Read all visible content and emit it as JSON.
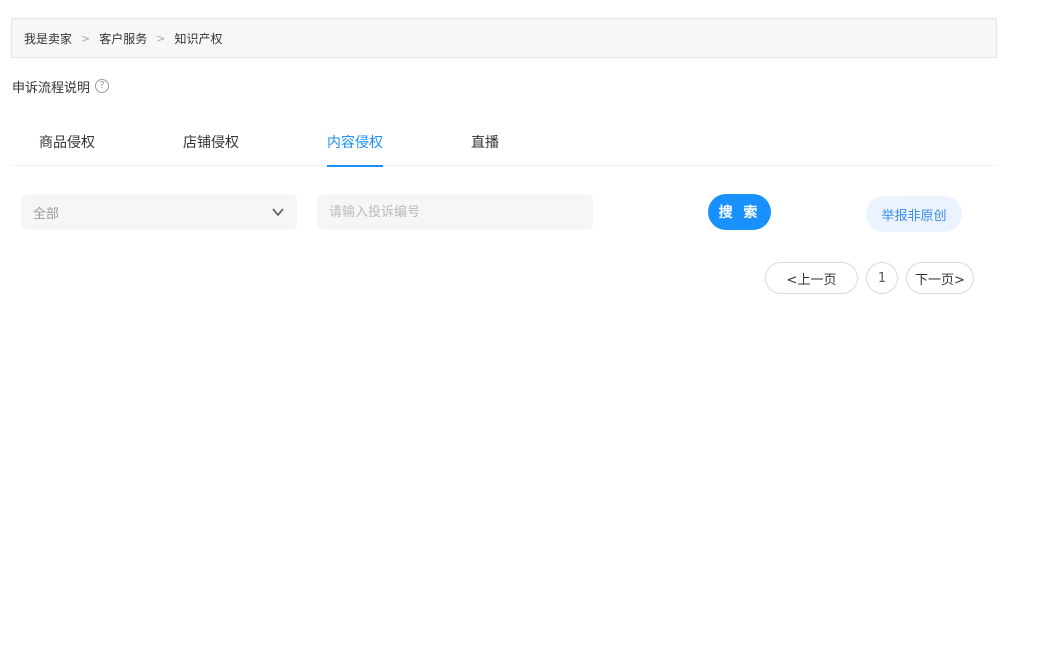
{
  "breadcrumb": {
    "items": [
      "我是卖家",
      "客户服务",
      "知识产权"
    ],
    "separator": ">"
  },
  "process": {
    "label": "申诉流程说明",
    "help_icon": "?"
  },
  "tabs": [
    {
      "label": "商品侵权",
      "active": false
    },
    {
      "label": "店铺侵权",
      "active": false
    },
    {
      "label": "内容侵权",
      "active": true
    },
    {
      "label": "直播",
      "active": false
    }
  ],
  "filter": {
    "select_value": "全部",
    "search_placeholder": "请输入投诉编号",
    "search_value": ""
  },
  "actions": {
    "search_label": "搜 索",
    "report_label": "举报非原创"
  },
  "pagination": {
    "prev_label": "<上一页",
    "current_page": "1",
    "next_label": "下一页>"
  },
  "colors": {
    "accent": "#1890ff",
    "report_bg": "#eaf3ff",
    "report_text": "#3c8cf0",
    "breadcrumb_bg": "#f7f7f7",
    "input_bg": "#f5f6f8"
  }
}
